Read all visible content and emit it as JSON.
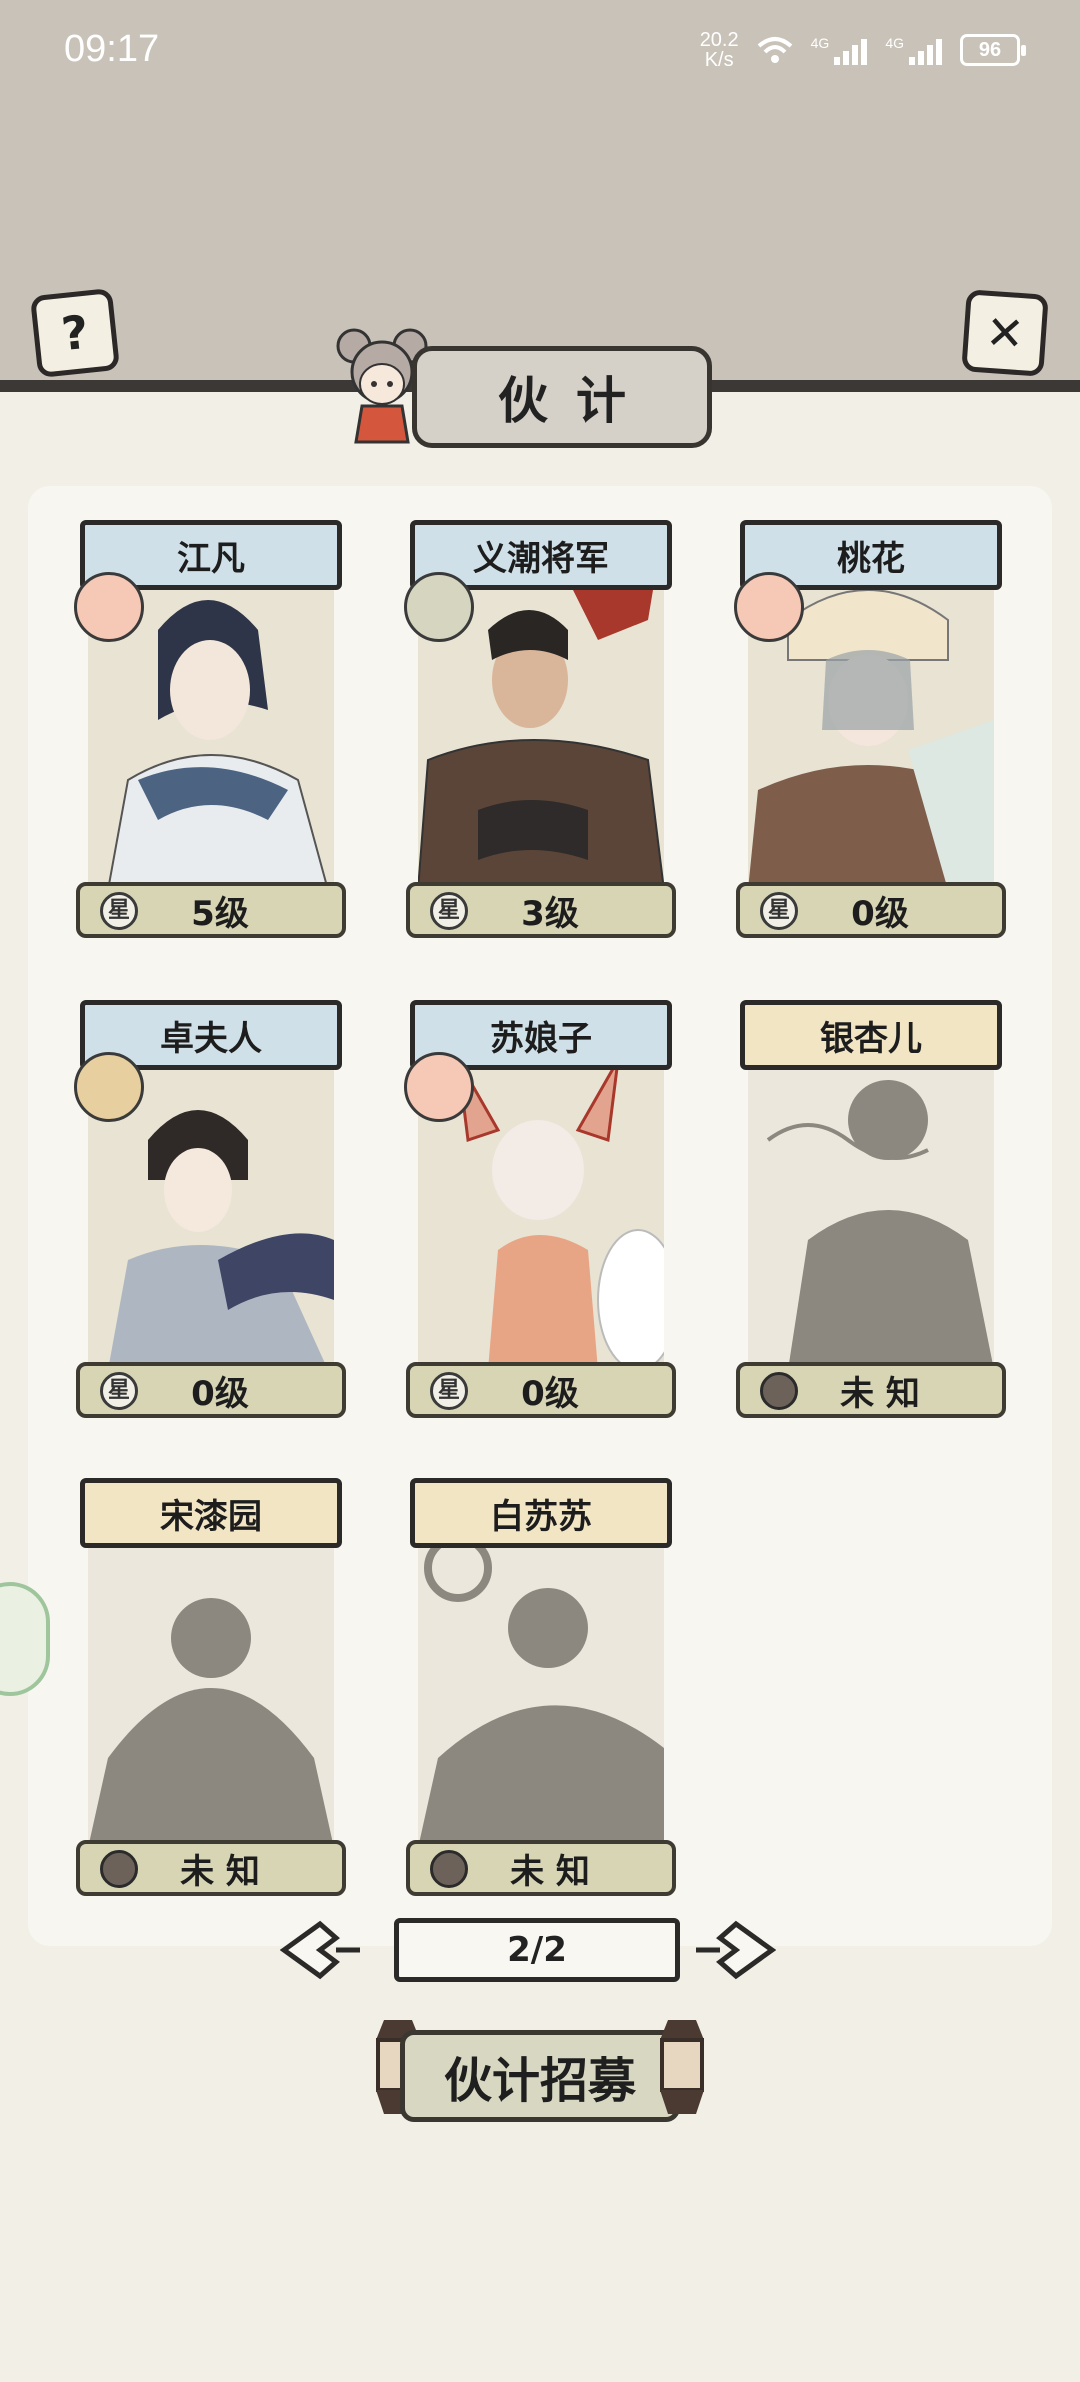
{
  "status": {
    "time": "09:17",
    "net_speed_top": "20.2",
    "net_speed_bottom": "K/s",
    "signal1": "4G",
    "signal2": "4G",
    "battery": "96"
  },
  "header": {
    "title": "伙计",
    "help_label": "?",
    "close_label": "✕"
  },
  "characters": [
    {
      "name": "江凡",
      "level": "5级",
      "plate": "blue",
      "mood": "happy",
      "unlocked": true
    },
    {
      "name": "义潮将军",
      "level": "3级",
      "plate": "blue",
      "mood": "sad",
      "unlocked": true
    },
    {
      "name": "桃花",
      "level": "0级",
      "plate": "blue",
      "mood": "happy",
      "unlocked": true
    },
    {
      "name": "卓夫人",
      "level": "0级",
      "plate": "blue",
      "mood": "neutral",
      "unlocked": true
    },
    {
      "name": "苏娘子",
      "level": "0级",
      "plate": "blue",
      "mood": "happy",
      "unlocked": true
    },
    {
      "name": "银杏儿",
      "level": "未 知",
      "plate": "gold",
      "mood": "",
      "unlocked": false
    },
    {
      "name": "宋漆园",
      "level": "未 知",
      "plate": "gold",
      "mood": "",
      "unlocked": false
    },
    {
      "name": "白苏苏",
      "level": "未 知",
      "plate": "gold",
      "mood": "",
      "unlocked": false
    }
  ],
  "level_icon_glyph": "星",
  "pager": {
    "label": "2/2"
  },
  "recruit": {
    "label": "伙计招募"
  },
  "colors": {
    "status_bg": "#c9c2b8",
    "page_bg": "#f1efe6",
    "plate_blue": "#cfe0e8",
    "plate_gold": "#f1e5c4",
    "level_plate": "#d8d5b5"
  }
}
